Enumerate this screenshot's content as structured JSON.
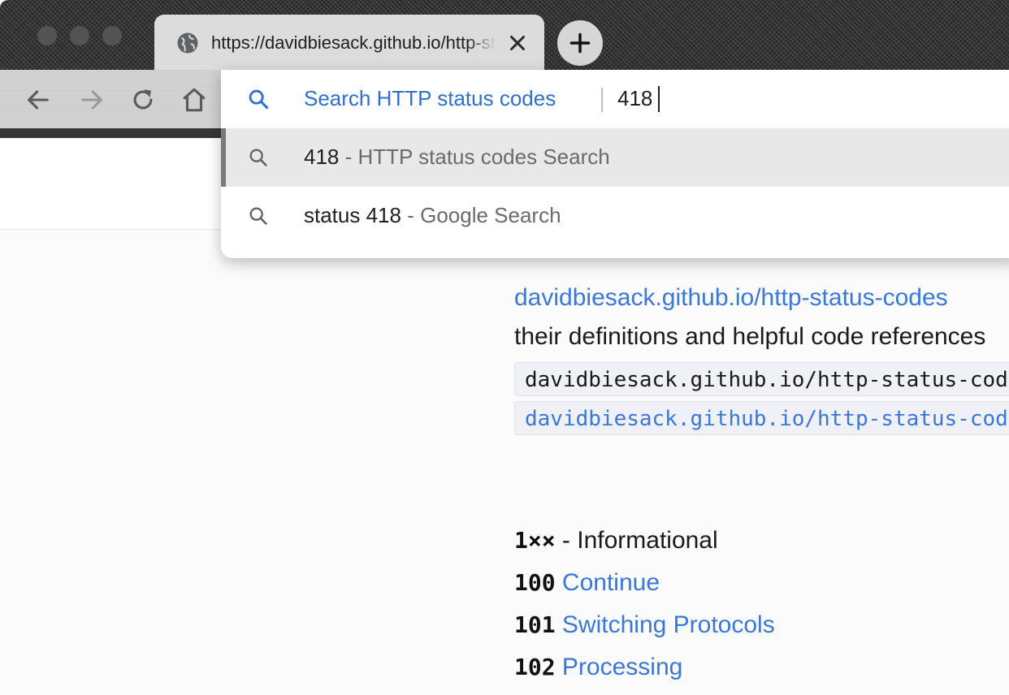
{
  "tab": {
    "title": "https://davidbiesack.github.io/http-status-codes"
  },
  "omnibox": {
    "keyword_label": "Search HTTP status codes",
    "query": "418",
    "suggestions": [
      {
        "main": "418",
        "rest": " - HTTP status codes Search"
      },
      {
        "main": "status 418",
        "rest": " - Google Search"
      }
    ]
  },
  "page": {
    "link_text": "davidbiesack.github.io/http-status-codes",
    "desc_text": "their definitions and helpful code references",
    "code_lines": [
      "davidbiesack.github.io/http-status-codes",
      "davidbiesack.github.io/http-status-codes"
    ],
    "section": {
      "code": "1××",
      "label": " - Informational"
    },
    "statuses": [
      {
        "code": "100",
        "name": "Continue"
      },
      {
        "code": "101",
        "name": "Switching Protocols"
      },
      {
        "code": "102",
        "name": "Processing"
      }
    ]
  },
  "colors": {
    "link": "#3a78d8",
    "keyword": "#2f6fcf"
  },
  "icons": [
    "globe-icon",
    "close-icon",
    "plus-icon",
    "back-icon",
    "forward-icon",
    "reload-icon",
    "home-icon",
    "search-icon"
  ]
}
